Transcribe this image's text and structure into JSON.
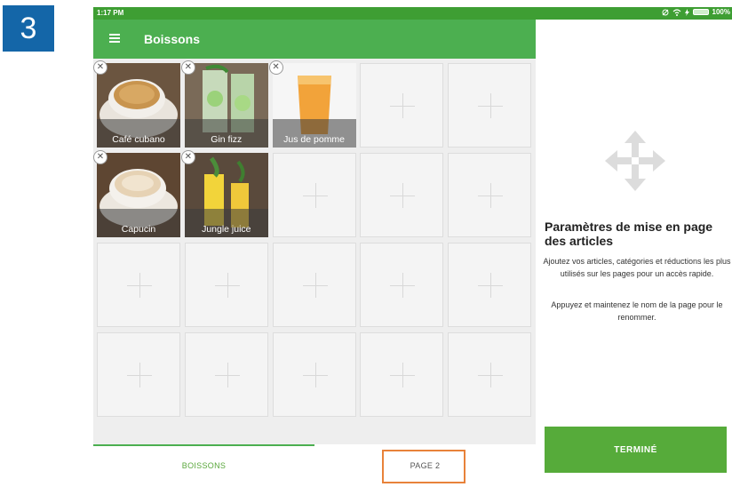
{
  "step": {
    "number": "3"
  },
  "status_bar": {
    "time": "1:17 PM",
    "battery": "100%"
  },
  "app_bar": {
    "title": "Boissons"
  },
  "items": [
    {
      "name": "Café cubano",
      "remove": "✕"
    },
    {
      "name": "Gin fizz",
      "remove": "✕"
    },
    {
      "name": "Jus de pomme",
      "remove": "✕"
    },
    {
      "name": "Capucin",
      "remove": "✕"
    },
    {
      "name": "Jungle juice",
      "remove": "✕"
    }
  ],
  "grid": {
    "columns": 5,
    "rows": 4,
    "total_tiles": 20
  },
  "tabs": {
    "active": "BOISSONS",
    "other": "PAGE 2"
  },
  "panel": {
    "title": "Paramètres de mise en page des articles",
    "description_1": "Ajoutez vos articles, catégories et réductions les plus utilisés sur les pages pour un accès rapide.",
    "description_2": "Appuyez et maintenez le nom de la page pour le renommer.",
    "done_label": "TERMINÉ"
  },
  "colors": {
    "green": "#4caf50",
    "done_green": "#56ab3a",
    "highlight": "#e8823a",
    "step_blue": "#1466a8"
  },
  "icons": {
    "menu": "menu-icon",
    "move": "move-icon",
    "remove": "close-icon"
  }
}
